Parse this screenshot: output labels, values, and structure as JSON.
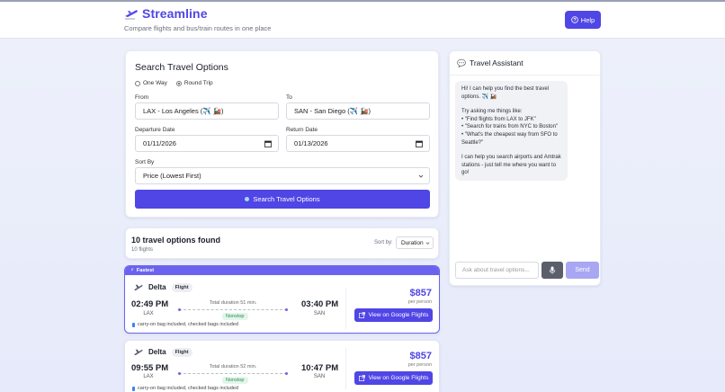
{
  "header": {
    "brand": "Streamline",
    "tagline": "Compare flights and bus/train routes in one place",
    "help_label": "Help"
  },
  "search": {
    "title": "Search Travel Options",
    "trip_types": [
      {
        "label": "One Way",
        "selected": false
      },
      {
        "label": "Round Trip",
        "selected": true
      }
    ],
    "from_label": "From",
    "from_value": "LAX - Los Angeles (✈️ 🚂)",
    "to_label": "To",
    "to_value": "SAN - San Diego (✈️ 🚂)",
    "departure_label": "Departure Date",
    "departure_value": "01/11/2026",
    "return_label": "Return Date",
    "return_value": "01/13/2026",
    "sort_label": "Sort By",
    "sort_value": "Price (Lowest First)",
    "button_label": "Search Travel Options"
  },
  "results": {
    "title": "10 travel options found",
    "subtitle": "10 flights",
    "sort_label": "Sort by:",
    "sort_value": "Duration"
  },
  "flights": [
    {
      "badge": "Fastest",
      "airline": "Delta",
      "type": "Flight",
      "depart_time": "02:49 PM",
      "depart_code": "LAX",
      "arrive_time": "03:40 PM",
      "arrive_code": "SAN",
      "duration": "Total duration 51 min.",
      "stops": "Nonstop",
      "bags": "carry-on bag included, checked bags included",
      "price": "$857",
      "price_unit": "per person",
      "cta": "View on Google Flights"
    },
    {
      "badge": "",
      "airline": "Delta",
      "type": "Flight",
      "depart_time": "09:55 PM",
      "depart_code": "LAX",
      "arrive_time": "10:47 PM",
      "arrive_code": "SAN",
      "duration": "Total duration 52 min.",
      "stops": "Nonstop",
      "bags": "carry-on bag included, checked bags included",
      "price": "$857",
      "price_unit": "per person",
      "cta": "View on Google Flights"
    }
  ],
  "assistant": {
    "title": "Travel Assistant",
    "greeting": "Hi! I can help you find the best travel options. ✈️ 🚂",
    "try_intro": "Try asking me things like:",
    "examples": [
      "• \"Find flights from LAX to JFK\"",
      "• \"Search for trains from NYC to Boston\"",
      "• \"What's the cheapest way from SFO to Seattle?\""
    ],
    "closing": "I can help you search airports and Amtrak stations - just tell me where you want to go!",
    "input_placeholder": "Ask about travel options...",
    "send_label": "Send"
  },
  "colors": {
    "accent": "#4f46e5",
    "fastest_border": "#6b63ef",
    "nonstop": "#2e8b57"
  }
}
